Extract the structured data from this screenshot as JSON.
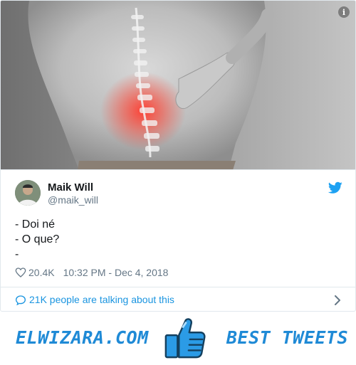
{
  "tweet": {
    "author_name": "Maik Will",
    "author_handle": "@maik_will",
    "lines": [
      "- Doi né",
      "- O que?",
      "-"
    ],
    "likes": "20.4K",
    "timestamp": "10:32 PM - Dec 4, 2018",
    "talking": "21K people are talking about this"
  },
  "banner": {
    "left_text": "ELWIZARA.COM",
    "right_text": "BEST TWEETS"
  },
  "icons": {
    "media_info": "info-icon",
    "brand": "twitter-bird-icon",
    "like": "heart-icon",
    "reply": "speech-bubble-icon",
    "more": "chevron-right-icon",
    "banner_center": "thumbs-up-icon"
  },
  "colors": {
    "twitter_blue": "#1da1f2",
    "link_blue": "#1b95e0",
    "banner_blue": "#1f8ad6",
    "muted": "#657786"
  },
  "info_glyph": "i"
}
